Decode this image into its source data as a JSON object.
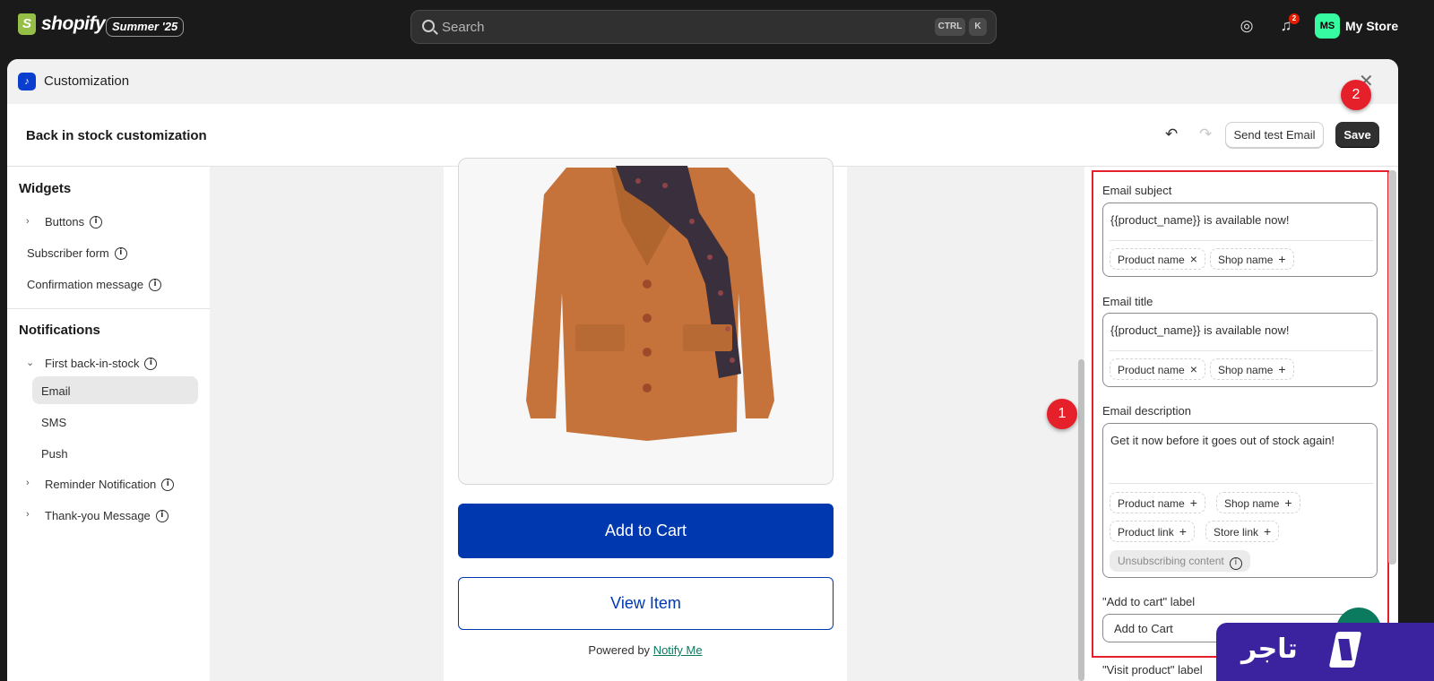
{
  "topbar": {
    "logo_text": "shopify",
    "edition": "Summer '25",
    "search_placeholder": "Search",
    "shortcut_ctrl": "CTRL",
    "shortcut_key": "K",
    "notifications_count": "2",
    "avatar_initials": "MS",
    "store_name": "My Store"
  },
  "modal": {
    "title": "Customization",
    "page_title": "Back in stock customization",
    "send_test_label": "Send test Email",
    "save_label": "Save"
  },
  "sidebar": {
    "widgets_title": "Widgets",
    "widgets": [
      "Buttons",
      "Subscriber form",
      "Confirmation message"
    ],
    "notifications_title": "Notifications",
    "first_group": "First back-in-stock",
    "first_children": [
      "Email",
      "SMS",
      "Push"
    ],
    "reminder": "Reminder Notification",
    "thankyou": "Thank-you Message"
  },
  "preview": {
    "add_to_cart": "Add to Cart",
    "view_item": "View Item",
    "powered_by": "Powered by",
    "powered_link": "Notify Me"
  },
  "panel": {
    "email_subject_label": "Email subject",
    "email_subject_value": "{{product_name}} is available now!",
    "email_title_label": "Email title",
    "email_title_value": "{{product_name}} is available now!",
    "email_description_label": "Email description",
    "email_description_value": "Get it now before it goes out of stock again!",
    "chip_product_name": "Product name",
    "chip_shop_name": "Shop name",
    "chip_product_link": "Product link",
    "chip_store_link": "Store link",
    "chip_unsubscribe": "Unsubscribing content",
    "add_to_cart_label": "\"Add to cart\" label",
    "add_to_cart_value": "Add to Cart",
    "visit_product_label": "\"Visit product\" label"
  },
  "annotations": {
    "marker_1": "1",
    "marker_2": "2"
  },
  "watermark": {
    "text": "تاجر"
  },
  "colors": {
    "accent": "#0038b0",
    "highlight": "#e5202b",
    "avatar": "#36fba1"
  }
}
